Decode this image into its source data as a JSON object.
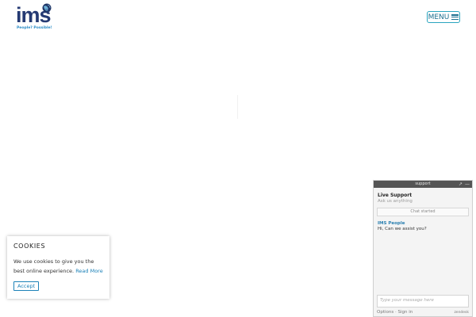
{
  "brand": {
    "wordmark": "ims",
    "trademark": "TM",
    "tagline": "People? Possible!"
  },
  "header": {
    "menu_label": "MENU"
  },
  "cookie": {
    "title": "COOKIES",
    "text": "We use cookies to give you the best online experience.",
    "read_more": "Read More",
    "accept": "Accept"
  },
  "chat": {
    "header_title": "support",
    "popout_icon": "↗",
    "minimize_icon": "—",
    "title": "Live Support",
    "subtitle": "Ask us anything",
    "status": "Chat started",
    "agent_name": "IMS People",
    "agent_message": "Hi, Can we assist you?",
    "input_placeholder": "Type your message here",
    "footer_options": "Options",
    "footer_sep": "·",
    "footer_signin": "Sign in",
    "powered_by": "zendesk"
  },
  "colors": {
    "brand_navy": "#253a73",
    "accent_teal": "#2aa5bf",
    "link_blue": "#1d82b8",
    "chat_header": "#555555"
  }
}
